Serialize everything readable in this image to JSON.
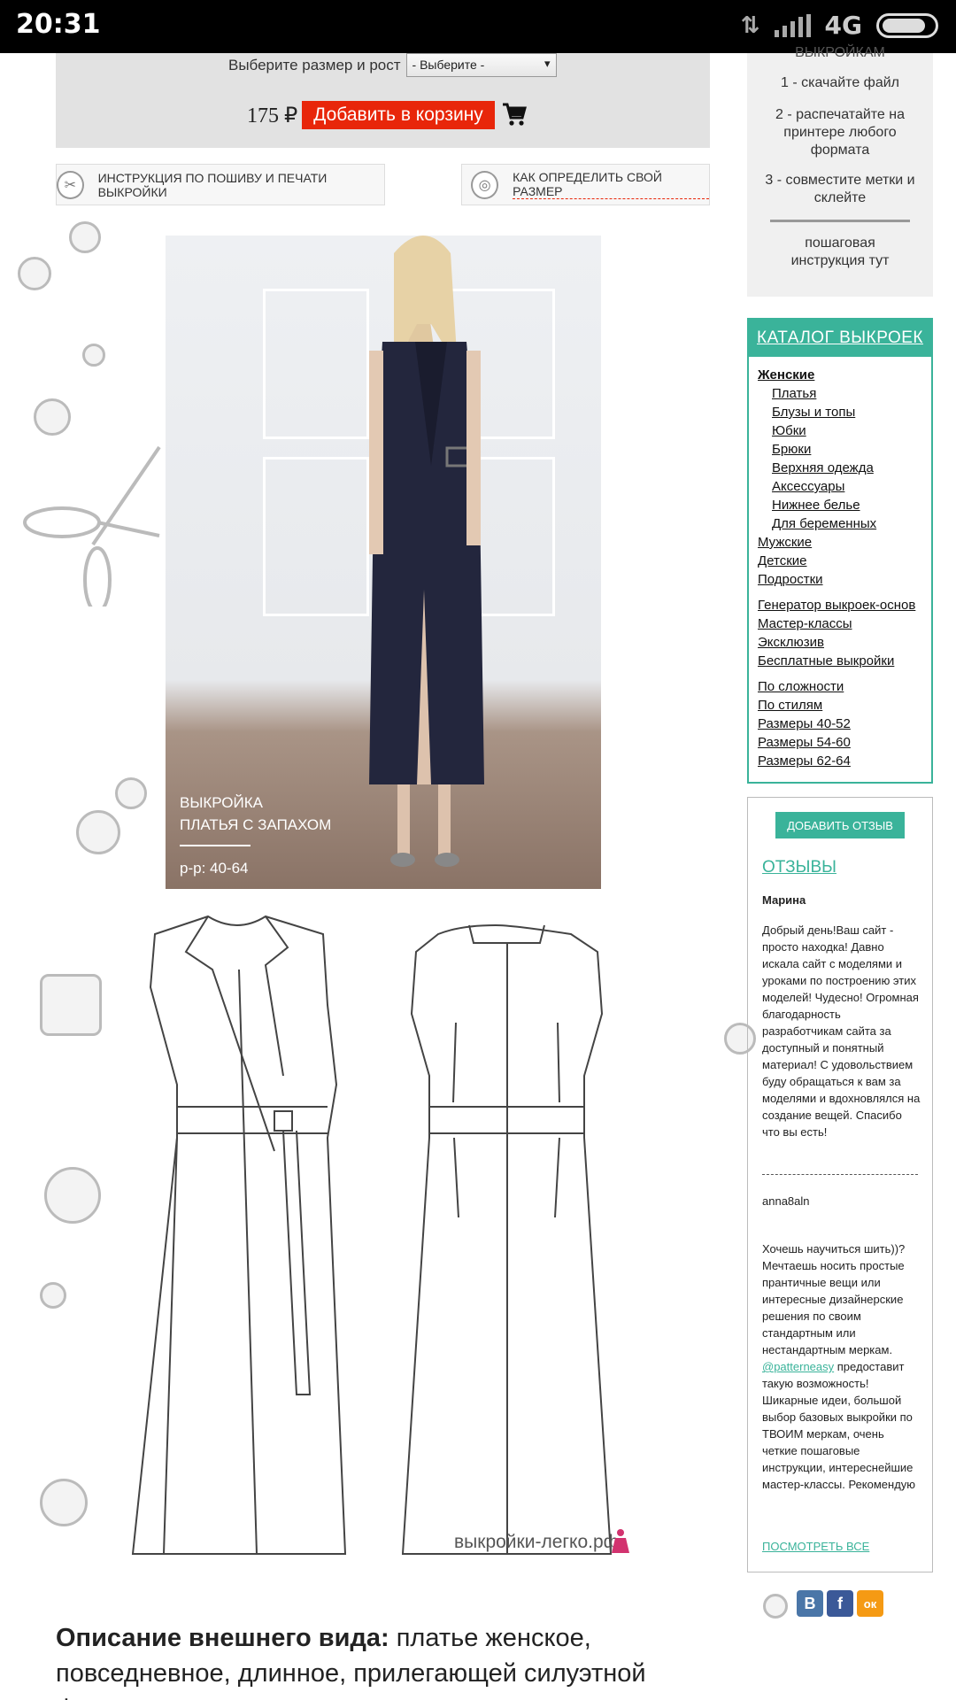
{
  "status_bar": {
    "time": "20:31",
    "network": "4G"
  },
  "cart": {
    "size_label": "Выберите размер и рост",
    "size_select_value": "- Выберите -",
    "price": "175 ₽",
    "add_to_cart_label": "Добавить в корзину"
  },
  "info_buttons": {
    "instruction_label": "ИНСТРУКЦИЯ ПО ПОШИВУ И ПЕЧАТИ ВЫКРОЙКИ",
    "size_guide_label": "КАК ОПРЕДЕЛИТЬ СВОЙ РАЗМЕР"
  },
  "photo": {
    "caption_line1": "ВЫКРОЙКА",
    "caption_line2": "ПЛАТЬЯ С ЗАПАХОМ",
    "sizes": "р-р: 40-64"
  },
  "sketch": {
    "watermark": "выкройки-легко.рф"
  },
  "description": {
    "heading": "Описание внешнего вида:",
    "text": "платье женское, повседневное, длинное, прилегающей силуэтной формы"
  },
  "steps": {
    "header_partial": "ВЫКРОЙКАМ",
    "step1": "1 - скачайте файл",
    "step2": "2 - распечатайте на принтере любого формата",
    "step3": "3 - совместите метки и склейте",
    "instruction_link": "пошаговая инструкция тут"
  },
  "catalog": {
    "title": "КАТАЛОГ ВЫКРОЕК",
    "women": "Женские",
    "women_items": [
      "Платья",
      "Блузы и топы",
      "Юбки",
      "Брюки",
      "Верхняя одежда",
      "Аксессуары",
      "Нижнее белье",
      "Для беременных"
    ],
    "men": "Мужские",
    "kids": "Детские",
    "teens": "Подростки",
    "group2": [
      "Генератор выкроек-основ",
      "Мастер-классы",
      "Эксклюзив",
      "Бесплатные выкройки"
    ],
    "group3": [
      "По сложности",
      "По стилям",
      "Размеры 40-52",
      "Размеры 54-60",
      "Размеры 62-64"
    ]
  },
  "reviews": {
    "add_button": "ДОБАВИТЬ ОТЗЫВ",
    "title": "ОТЗЫВЫ",
    "review1_author": "Марина",
    "review1_text": "Добрый день!Ваш сайт - просто находка! Давно искала сайт с моделями и уроками по построению этих моделей! Чудесно! Огромная благодарность разработчикам сайта за доступный и понятный материал! С удовольствием буду обращаться к вам за моделями и вдохновлялся на создание вещей. Спасибо что вы есть!",
    "review2_author": "anna8aln",
    "review2_text_before": "Хочешь научиться шить))? Мечтаешь носить простые прантичные вещи или интересные дизайнерские решения по своим стандартным или нестандартным меркам.",
    "review2_tag": "@patterneasy",
    "review2_text_after": "предоставит такую возможность! Шикарные идеи, большой выбор базовых выкройки по ТВОИМ меркам, очень четкие пошаговые инструкции, интереснейшие мастер-классы. Рекомендую",
    "see_all": "ПОСМОТРЕТЬ ВСЕ"
  },
  "social": {
    "vk": "В",
    "fb": "f",
    "ok": "ок"
  },
  "colors": {
    "accent": "#3ab39a",
    "cart_button": "#e8260a",
    "vk": "#4a76a8",
    "fb": "#3b5998",
    "ok": "#f59a14"
  }
}
